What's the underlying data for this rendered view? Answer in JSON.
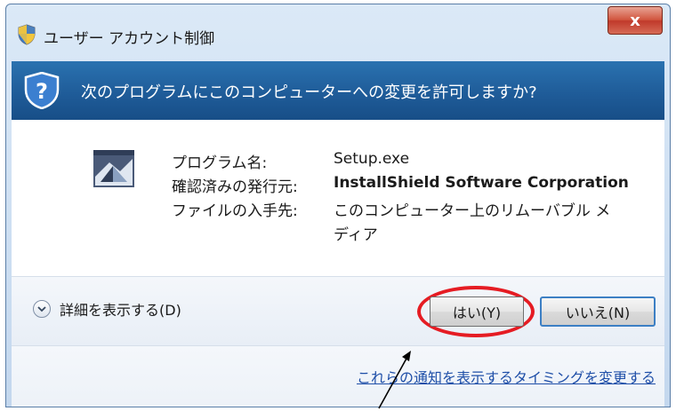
{
  "window": {
    "title": "ユーザー アカウント制御",
    "close_label": "x"
  },
  "banner": {
    "question": "次のプログラムにこのコンピューターへの変更を許可しますか?"
  },
  "info": {
    "program_label": "プログラム名:",
    "program_value": "Setup.exe",
    "publisher_label": "確認済みの発行元:",
    "publisher_value": "InstallShield Software Corporation",
    "origin_label": "ファイルの入手先:",
    "origin_value_line1": "このコンピューター上のリムーバブル メ",
    "origin_value_line2": "ディア"
  },
  "actions": {
    "details_label": "詳細を表示する(D)",
    "yes_label": "はい(Y)",
    "no_label": "いいえ(N)"
  },
  "footer": {
    "link_label": "これらの通知を表示するタイミングを変更する"
  },
  "icons": [
    "shield-icon",
    "help-shield-icon",
    "program-icon",
    "chevron-down-icon",
    "close-icon"
  ],
  "colors": {
    "banner": "#1f5c99",
    "highlight": "#e51c23",
    "link": "#1f4fa8"
  }
}
